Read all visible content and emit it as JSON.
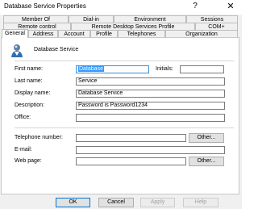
{
  "window": {
    "title": "Database Service Properties",
    "help_glyph": "?",
    "close_glyph": "✕"
  },
  "tabs": {
    "row1": [
      "Member Of",
      "Dial-in",
      "Environment",
      "Sessions"
    ],
    "row2": [
      "Remote control",
      "Remote Desktop Services Profile",
      "COM+"
    ],
    "row3": [
      "General",
      "Address",
      "Account",
      "Profile",
      "Telephones",
      "Organization"
    ],
    "active": "General"
  },
  "general": {
    "object_name": "Database Service",
    "first_name_label": "First name:",
    "first_name_value": "Database",
    "initials_label": "Initials:",
    "initials_value": "",
    "last_name_label": "Last name:",
    "last_name_value": "Service",
    "display_name_label": "Display name:",
    "display_name_value": "Database Service",
    "description_label": "Description:",
    "description_value": "Password is Password1234",
    "office_label": "Office:",
    "office_value": "",
    "telephone_label": "Telephone number:",
    "telephone_value": "",
    "telephone_other_label": "Other...",
    "email_label": "E-mail:",
    "email_value": "",
    "webpage_label": "Web page:",
    "webpage_value": "",
    "webpage_other_label": "Other..."
  },
  "footer": {
    "ok_label": "OK",
    "cancel_label": "Cancel",
    "apply_label": "Apply",
    "help_label": "Help"
  }
}
